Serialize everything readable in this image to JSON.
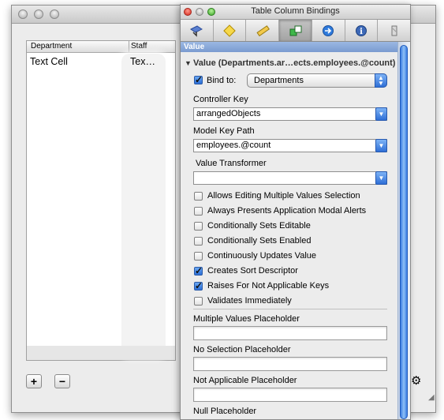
{
  "back_window": {
    "table": {
      "columns": [
        "Department",
        "Staff"
      ],
      "row": {
        "department": "Text Cell",
        "staff": "Tex…"
      }
    },
    "add_label": "+",
    "remove_label": "−"
  },
  "inspector": {
    "title": "Table Column Bindings",
    "tabs": [
      {
        "icon": "attributes-icon"
      },
      {
        "icon": "effects-icon"
      },
      {
        "icon": "size-icon"
      },
      {
        "icon": "bindings-icon",
        "selected": true
      },
      {
        "icon": "connections-icon"
      },
      {
        "icon": "identity-icon"
      },
      {
        "icon": "applescript-icon"
      }
    ],
    "section_title": "Value",
    "value_header": "Value (Departments.ar…ects.employees.@count)",
    "bind_to": {
      "label": "Bind to:",
      "checked": true,
      "value": "Departments"
    },
    "controller_key": {
      "label": "Controller Key",
      "value": "arrangedObjects"
    },
    "model_key_path": {
      "label": "Model Key Path",
      "value": "employees.@count"
    },
    "value_transformer": {
      "label": "Value Transformer",
      "value": ""
    },
    "options": [
      {
        "label": "Allows Editing Multiple Values Selection",
        "checked": false
      },
      {
        "label": "Always Presents Application Modal Alerts",
        "checked": false
      },
      {
        "label": "Conditionally Sets Editable",
        "checked": false
      },
      {
        "label": "Conditionally Sets Enabled",
        "checked": false
      },
      {
        "label": "Continuously Updates Value",
        "checked": false
      },
      {
        "label": "Creates Sort Descriptor",
        "checked": true
      },
      {
        "label": "Raises For Not Applicable Keys",
        "checked": true
      },
      {
        "label": "Validates Immediately",
        "checked": false
      }
    ],
    "placeholders": [
      {
        "label": "Multiple Values Placeholder",
        "value": ""
      },
      {
        "label": "No Selection Placeholder",
        "value": ""
      },
      {
        "label": "Not Applicable Placeholder",
        "value": ""
      },
      {
        "label": "Null Placeholder",
        "value": ""
      }
    ]
  }
}
